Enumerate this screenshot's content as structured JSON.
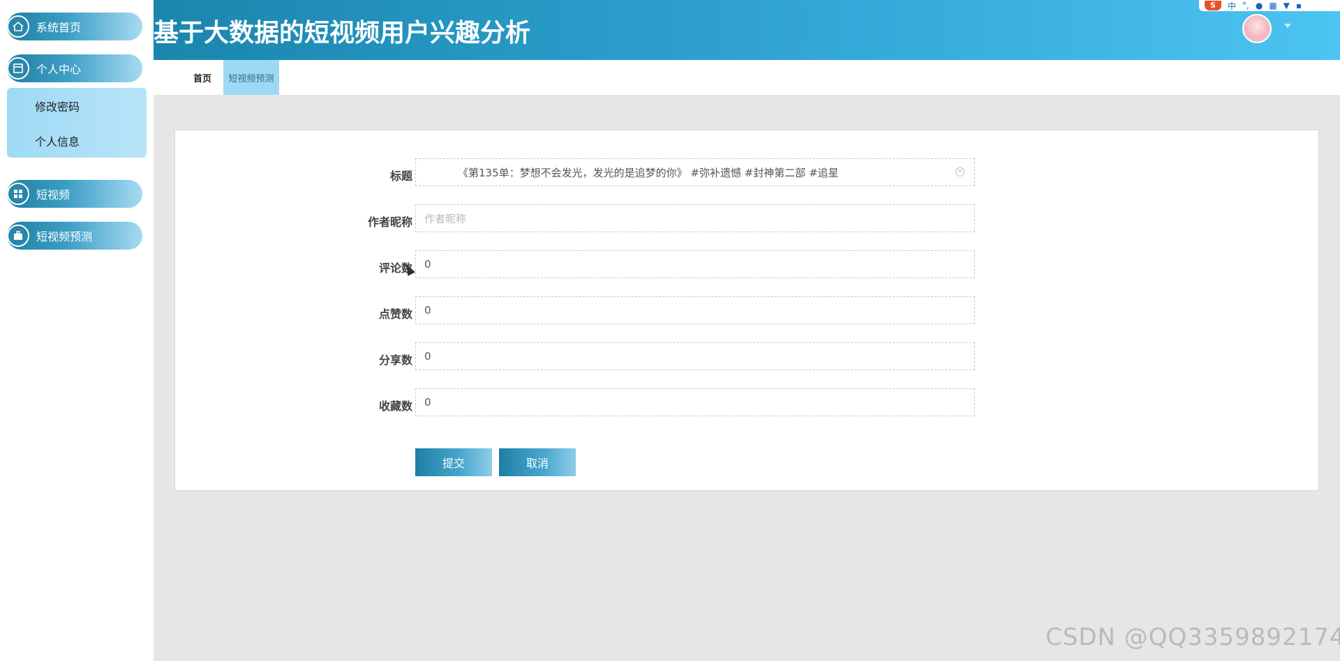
{
  "app": {
    "title": "基于大数据的短视频用户兴趣分析"
  },
  "sidebar": {
    "items": [
      {
        "label": "系统首页",
        "icon": "home-icon"
      },
      {
        "label": "个人中心",
        "icon": "window-icon"
      },
      {
        "label": "短视频",
        "icon": "grid-icon"
      },
      {
        "label": "短视频预测",
        "icon": "briefcase-icon"
      }
    ],
    "submenu": [
      {
        "label": "修改密码"
      },
      {
        "label": "个人信息"
      }
    ]
  },
  "tabs": [
    {
      "label": "首页",
      "active": false
    },
    {
      "label": "短视频预测",
      "active": true
    }
  ],
  "form": {
    "title_label": "标题",
    "title_value": "《第135单：梦想不会发光，发光的是追梦的你》 #弥补遗憾 #封神第二部 #追星",
    "author_label": "作者昵称",
    "author_placeholder": "作者昵称",
    "comments_label": "评论数",
    "comments_value": "0",
    "likes_label": "点赞数",
    "likes_value": "0",
    "shares_label": "分享数",
    "shares_value": "0",
    "favorites_label": "收藏数",
    "favorites_value": "0",
    "submit_label": "提交",
    "cancel_label": "取消"
  },
  "ime": {
    "mode": "中"
  },
  "watermark": "CSDN @QQ3359892174",
  "colors": {
    "header_start": "#1a86ad",
    "header_end": "#4cc4f2",
    "active_tab": "#9ed9f3",
    "submenu_bg": "#9fdaf5"
  }
}
